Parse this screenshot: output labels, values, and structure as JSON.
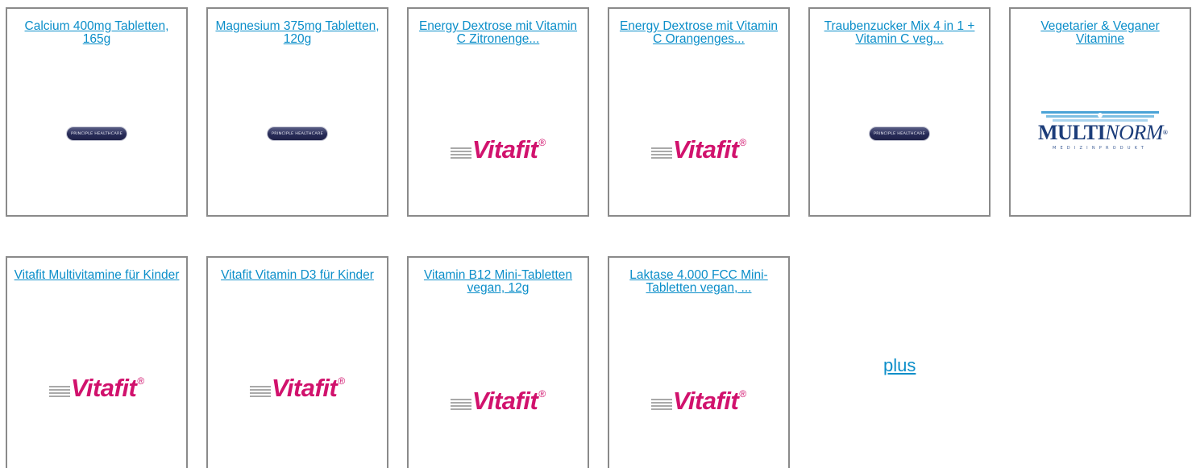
{
  "products": [
    {
      "title": "Calcium 400mg Tabletten, 165g",
      "brand": "principle-healthcare"
    },
    {
      "title": "Magnesium 375mg Tabletten, 120g",
      "brand": "principle-healthcare"
    },
    {
      "title": "Energy Dextrose mit Vitamin C Zitronenge...",
      "brand": "vitafit"
    },
    {
      "title": "Energy Dextrose mit Vitamin C Orangenges...",
      "brand": "vitafit"
    },
    {
      "title": "Traubenzucker Mix 4 in 1 + Vitamin C veg...",
      "brand": "principle-healthcare"
    },
    {
      "title": "Vegetarier & Veganer Vitamine",
      "brand": "multinorm"
    },
    {
      "title": "Vitafit Multivitamine für Kinder",
      "brand": "vitafit"
    },
    {
      "title": "Vitafit Vitamin D3 für Kinder",
      "brand": "vitafit"
    },
    {
      "title": "Vitamin B12 Mini-Tabletten vegan, 12g",
      "brand": "vitafit"
    },
    {
      "title": "Laktase 4.000 FCC Mini-Tabletten vegan, ...",
      "brand": "vitafit"
    }
  ],
  "logos": {
    "principle": {
      "text": "PRINCIPLE HEALTHCARE"
    },
    "vitafit": {
      "word": "Vitafit",
      "reg": "®",
      "color": "#d1126d"
    },
    "multinorm": {
      "word_a": "MULTI",
      "word_b": "NORM",
      "reg": "®",
      "sub": "MEDIZINPRODUKT",
      "color": "#1c3d7a"
    }
  },
  "more_link": "plus",
  "colors": {
    "link": "#0b8ec9",
    "border": "#8a8a8a"
  }
}
